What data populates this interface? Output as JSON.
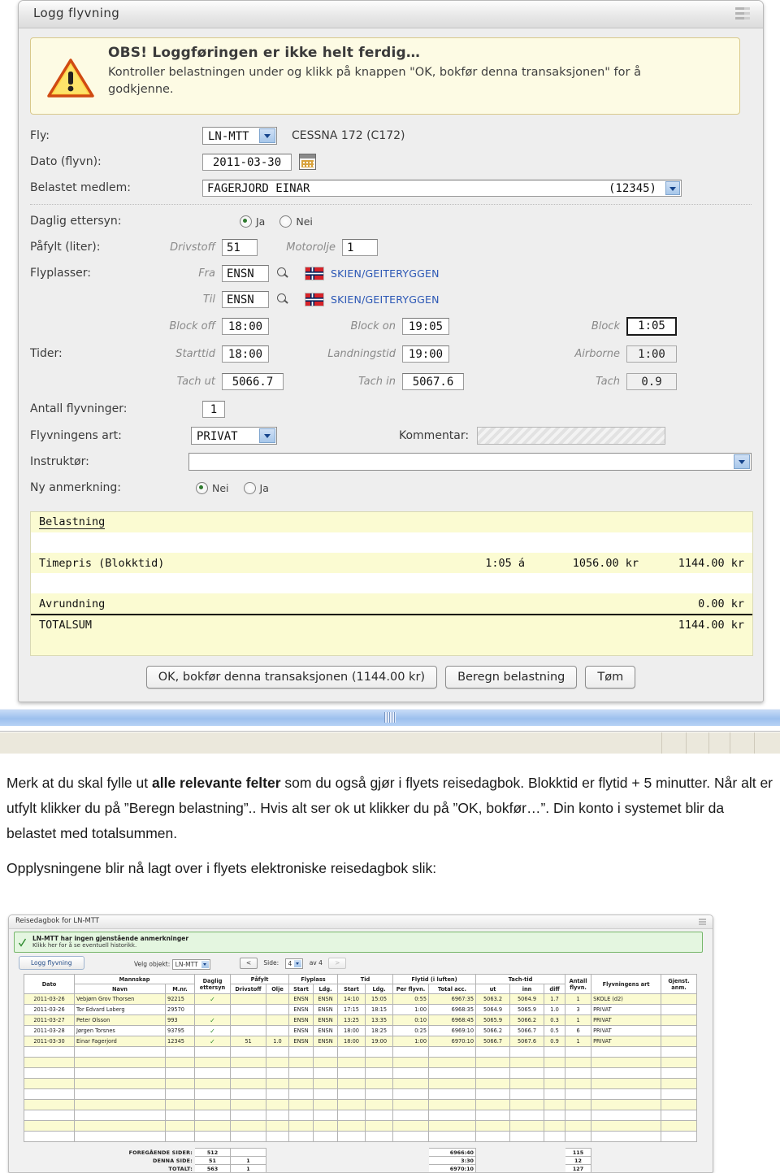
{
  "top_window": {
    "title": "Logg flyvning",
    "grid_icon": "grid-icon",
    "alert": {
      "icon": "warning-triangle-icon",
      "heading": "OBS! Loggføringen er ikke helt ferdig…",
      "body_line1": "Kontroller belastningen under og klikk på knappen \"OK, bokfør denna transaksjonen\" for å",
      "body_line2": "godkjenne."
    },
    "fields": {
      "fly_label": "Fly:",
      "fly_value": "LN-MTT",
      "fly_type": "CESSNA 172 (C172)",
      "dato_label": "Dato (flyvn):",
      "dato_value": "2011-03-30",
      "calendar_icon": "calendar-icon",
      "medlem_label": "Belastet medlem:",
      "medlem_value": "FAGERJORD   EINAR",
      "medlem_number": "(12345)",
      "ettersyn_label": "Daglig ettersyn:",
      "ettersyn_yes": "Ja",
      "ettersyn_no": "Nei",
      "ettersyn_selected": "Ja",
      "pafylt_label": "Påfylt (liter):",
      "drivstoff_label": "Drivstoff",
      "drivstoff_value": "51",
      "motorolje_label": "Motorolje",
      "motorolje_value": "1",
      "flyplasser_label": "Flyplasser:",
      "fra_label": "Fra",
      "fra_value": "ENSN",
      "fra_airport": "SKIEN/GEITERYGGEN",
      "til_label": "Til",
      "til_value": "ENSN",
      "til_airport": "SKIEN/GEITERYGGEN",
      "search_icon": "magnifier-icon",
      "flag_icon": "norway-flag-icon",
      "tider_label": "Tider:",
      "block_off_label": "Block off",
      "block_off_value": "18:00",
      "block_on_label": "Block on",
      "block_on_value": "19:05",
      "block_label": "Block",
      "block_value": "1:05",
      "starttid_label": "Starttid",
      "starttid_value": "18:00",
      "landingstid_label": "Landningstid",
      "landingstid_value": "19:00",
      "airborne_label": "Airborne",
      "airborne_value": "1:00",
      "tach_ut_label": "Tach ut",
      "tach_ut_value": "5066.7",
      "tach_in_label": "Tach in",
      "tach_in_value": "5067.6",
      "tach_label": "Tach",
      "tach_value": "0.9",
      "antall_label": "Antall flyvninger:",
      "antall_value": "1",
      "art_label": "Flyvningens art:",
      "art_value": "PRIVAT",
      "kommentar_label": "Kommentar:",
      "kommentar_value": "",
      "instruktor_label": "Instruktør:",
      "instruktor_value": "",
      "anmerkning_label": "Ny anmerkning:",
      "anmerkning_no": "Nei",
      "anmerkning_yes": "Ja",
      "anmerkning_selected": "Nei"
    },
    "belastning": {
      "heading": "Belastning",
      "rows": [
        {
          "label": "Timepris (Blokktid)",
          "qty": "1:05 á",
          "rate": "1056.00 kr",
          "amount": "1144.00 kr"
        },
        {
          "label": "Avrundning",
          "qty": "",
          "rate": "",
          "amount": "0.00 kr"
        }
      ],
      "total_label": "TOTALSUM",
      "total_amount": "1144.00 kr"
    },
    "buttons": {
      "ok": "OK, bokfør denna transaksjonen (1144.00 kr)",
      "beregn": "Beregn belastning",
      "tom": "Tøm"
    }
  },
  "prose": {
    "p1_a": "Merk at du skal fylle ut ",
    "p1_b": "alle relevante felter",
    "p1_c": " som du også gjør i flyets reisedagbok. Blokktid er flytid + 5 minutter. Når alt er utfylt klikker du på ”Beregn belastning”.. Hvis alt ser ok ut klikker du på ”OK, bokfør…”. Din konto i systemet blir da belastet med totalsummen.",
    "p2": "Opplysningene blir nå lagt over i flyets elektroniske reisedagbok slik:"
  },
  "bottom_window": {
    "title": "Reisedagbok for LN-MTT",
    "grid_icon": "grid-icon",
    "status": {
      "check_icon": "green-check-icon",
      "line1": "LN-MTT har ingen gjenstående anmerkninger",
      "line2": "Klikk her for å se eventuell historikk."
    },
    "toolbar": {
      "logg_button": "Logg flyvning",
      "velg_label": "Velg objekt:",
      "velg_value": "LN-MTT",
      "prev_button": "<",
      "side_label": "Side:",
      "side_value": "4",
      "av_label": "av 4",
      "next_button": ">"
    },
    "table": {
      "group_headers": [
        "",
        "Mannskap",
        "Daglig ettersyn",
        "Påfylt",
        "Flyplass",
        "Tid",
        "Flytid (i luften)",
        "Tach-tid",
        "Antall flyvn.",
        "Flyvningens art",
        "Gjenst. anm."
      ],
      "sub_headers": [
        "Dato",
        "Navn",
        "M.nr.",
        "",
        "Drivstoff",
        "Olje",
        "Start",
        "Ldg.",
        "Start",
        "Ldg.",
        "Per flyvn.",
        "Total acc.",
        "ut",
        "inn",
        "diff",
        "",
        "",
        ""
      ],
      "rows": [
        {
          "dato": "2011-03-26",
          "navn": "Vebjørn Grov Thorsen",
          "mnr": "92215",
          "ettersyn": "✓",
          "drivstoff": "",
          "olje": "",
          "start_plass": "ENSN",
          "ldg_plass": "ENSN",
          "start_tid": "14:10",
          "ldg_tid": "15:05",
          "per_flyvn": "0:55",
          "total_acc": "6967:35",
          "tach_ut": "5063.2",
          "tach_inn": "5064.9",
          "tach_diff": "1.7",
          "antall": "1",
          "art": "SKOLE (d2)",
          "anm": ""
        },
        {
          "dato": "2011-03-26",
          "navn": "Tor Edvard Loberg",
          "mnr": "29570",
          "ettersyn": "",
          "drivstoff": "",
          "olje": "",
          "start_plass": "ENSN",
          "ldg_plass": "ENSN",
          "start_tid": "17:15",
          "ldg_tid": "18:15",
          "per_flyvn": "1:00",
          "total_acc": "6968:35",
          "tach_ut": "5064.9",
          "tach_inn": "5065.9",
          "tach_diff": "1.0",
          "antall": "3",
          "art": "PRIVAT",
          "anm": ""
        },
        {
          "dato": "2011-03-27",
          "navn": "Peter Olsson",
          "mnr": "993",
          "ettersyn": "✓",
          "drivstoff": "",
          "olje": "",
          "start_plass": "ENSN",
          "ldg_plass": "ENSN",
          "start_tid": "13:25",
          "ldg_tid": "13:35",
          "per_flyvn": "0:10",
          "total_acc": "6968:45",
          "tach_ut": "5065.9",
          "tach_inn": "5066.2",
          "tach_diff": "0.3",
          "antall": "1",
          "art": "PRIVAT",
          "anm": ""
        },
        {
          "dato": "2011-03-28",
          "navn": "Jørgen Torsnes",
          "mnr": "93795",
          "ettersyn": "✓",
          "drivstoff": "",
          "olje": "",
          "start_plass": "ENSN",
          "ldg_plass": "ENSN",
          "start_tid": "18:00",
          "ldg_tid": "18:25",
          "per_flyvn": "0:25",
          "total_acc": "6969:10",
          "tach_ut": "5066.2",
          "tach_inn": "5066.7",
          "tach_diff": "0.5",
          "antall": "6",
          "art": "PRIVAT",
          "anm": ""
        },
        {
          "dato": "2011-03-30",
          "navn": "Einar Fagerjord",
          "mnr": "12345",
          "ettersyn": "✓",
          "drivstoff": "51",
          "olje": "1.0",
          "start_plass": "ENSN",
          "ldg_plass": "ENSN",
          "start_tid": "18:00",
          "ldg_tid": "19:00",
          "per_flyvn": "1:00",
          "total_acc": "6970:10",
          "tach_ut": "5066.7",
          "tach_inn": "5067.6",
          "tach_diff": "0.9",
          "antall": "1",
          "art": "PRIVAT",
          "anm": ""
        }
      ],
      "empty_rows": 9
    },
    "footer": {
      "rows": [
        {
          "label": "FOREGÅENDE SIDER:",
          "drivstoff": "512",
          "olje": "",
          "total_acc": "6966:40",
          "antall": "115"
        },
        {
          "label": "DENNA SIDE:",
          "drivstoff": "51",
          "olje": "1",
          "total_acc": "3:30",
          "antall": "12"
        },
        {
          "label": "TOTALT:",
          "drivstoff": "563",
          "olje": "1",
          "total_acc": "6970:10",
          "antall": "127"
        }
      ]
    }
  }
}
